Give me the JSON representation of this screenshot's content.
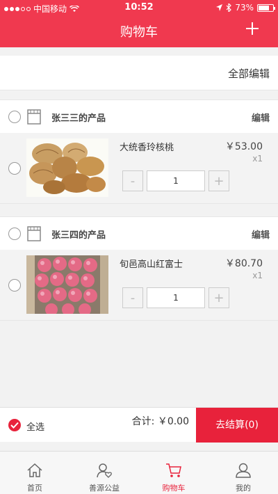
{
  "status_bar": {
    "carrier": "中国移动",
    "time": "10:52",
    "battery": "73%"
  },
  "header": {
    "title": "购物车"
  },
  "edit_all": {
    "label": "全部编辑"
  },
  "shops": [
    {
      "name": "张三三的产品",
      "edit_label": "编辑",
      "item": {
        "name": "大统香玲核桃",
        "price": "￥53.00",
        "qty": "x1",
        "stepper_minus": "-",
        "stepper_value": "1",
        "stepper_plus": "+"
      }
    },
    {
      "name": "张三四的产品",
      "edit_label": "编辑",
      "item": {
        "name": "旬邑高山红富士",
        "price": "￥80.70",
        "qty": "x1",
        "stepper_minus": "-",
        "stepper_value": "1",
        "stepper_plus": "+"
      }
    }
  ],
  "checkout": {
    "select_all_label": "全选",
    "total": "合计: ￥0.00",
    "settle_label": "去结算(0)"
  },
  "tabs": [
    {
      "label": "首页",
      "icon": "home-icon"
    },
    {
      "label": "善源公益",
      "icon": "charity-icon"
    },
    {
      "label": "购物车",
      "icon": "cart-icon"
    },
    {
      "label": "我的",
      "icon": "user-icon"
    }
  ],
  "colors": {
    "brand_red": "#f0394f",
    "accent_red": "#e8223b"
  }
}
